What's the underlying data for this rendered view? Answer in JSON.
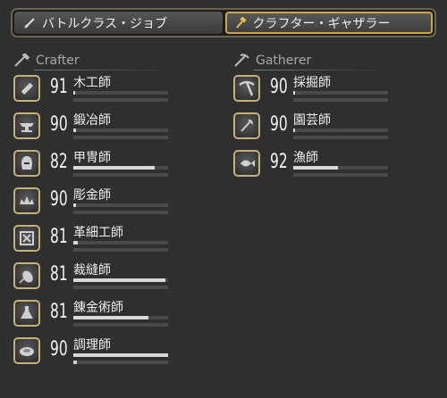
{
  "tabs": [
    {
      "label": "バトルクラス・ジョブ",
      "icon": "sword-icon",
      "active": false
    },
    {
      "label": "クラフター・ギャザラー",
      "icon": "hammer-icon",
      "active": true
    }
  ],
  "crafter": {
    "heading": "Crafter",
    "jobs": [
      {
        "name": "木工師",
        "level": "91",
        "icon": "saw-icon",
        "progress": 0.02,
        "progress2": 0.0
      },
      {
        "name": "鍛冶師",
        "level": "90",
        "icon": "anvil-icon",
        "progress": 0.03,
        "progress2": 0.0
      },
      {
        "name": "甲冑師",
        "level": "82",
        "icon": "helmet-icon",
        "progress": 0.86,
        "progress2": 0.0
      },
      {
        "name": "彫金師",
        "level": "90",
        "icon": "tiara-icon",
        "progress": 0.03,
        "progress2": 0.0
      },
      {
        "name": "革細工師",
        "level": "81",
        "icon": "leather-icon",
        "progress": 0.05,
        "progress2": 0.0
      },
      {
        "name": "裁縫師",
        "level": "81",
        "icon": "thread-icon",
        "progress": 0.97,
        "progress2": 0.0
      },
      {
        "name": "錬金術師",
        "level": "81",
        "icon": "flask-icon",
        "progress": 0.79,
        "progress2": 0.0
      },
      {
        "name": "調理師",
        "level": "90",
        "icon": "cooking-icon",
        "progress": 1.0,
        "progress2": 0.04
      }
    ]
  },
  "gatherer": {
    "heading": "Gatherer",
    "jobs": [
      {
        "name": "採掘師",
        "level": "90",
        "icon": "pickaxe-icon",
        "progress": 0.02,
        "progress2": 0.0
      },
      {
        "name": "園芸師",
        "level": "90",
        "icon": "hatchet-icon",
        "progress": 0.02,
        "progress2": 0.0
      },
      {
        "name": "漁師",
        "level": "92",
        "icon": "fish-icon",
        "progress": 0.47,
        "progress2": 0.0
      }
    ]
  },
  "colors": {
    "accent": "#c9a64a",
    "frame": "#c6b07a",
    "background": "#2f2f2f"
  }
}
